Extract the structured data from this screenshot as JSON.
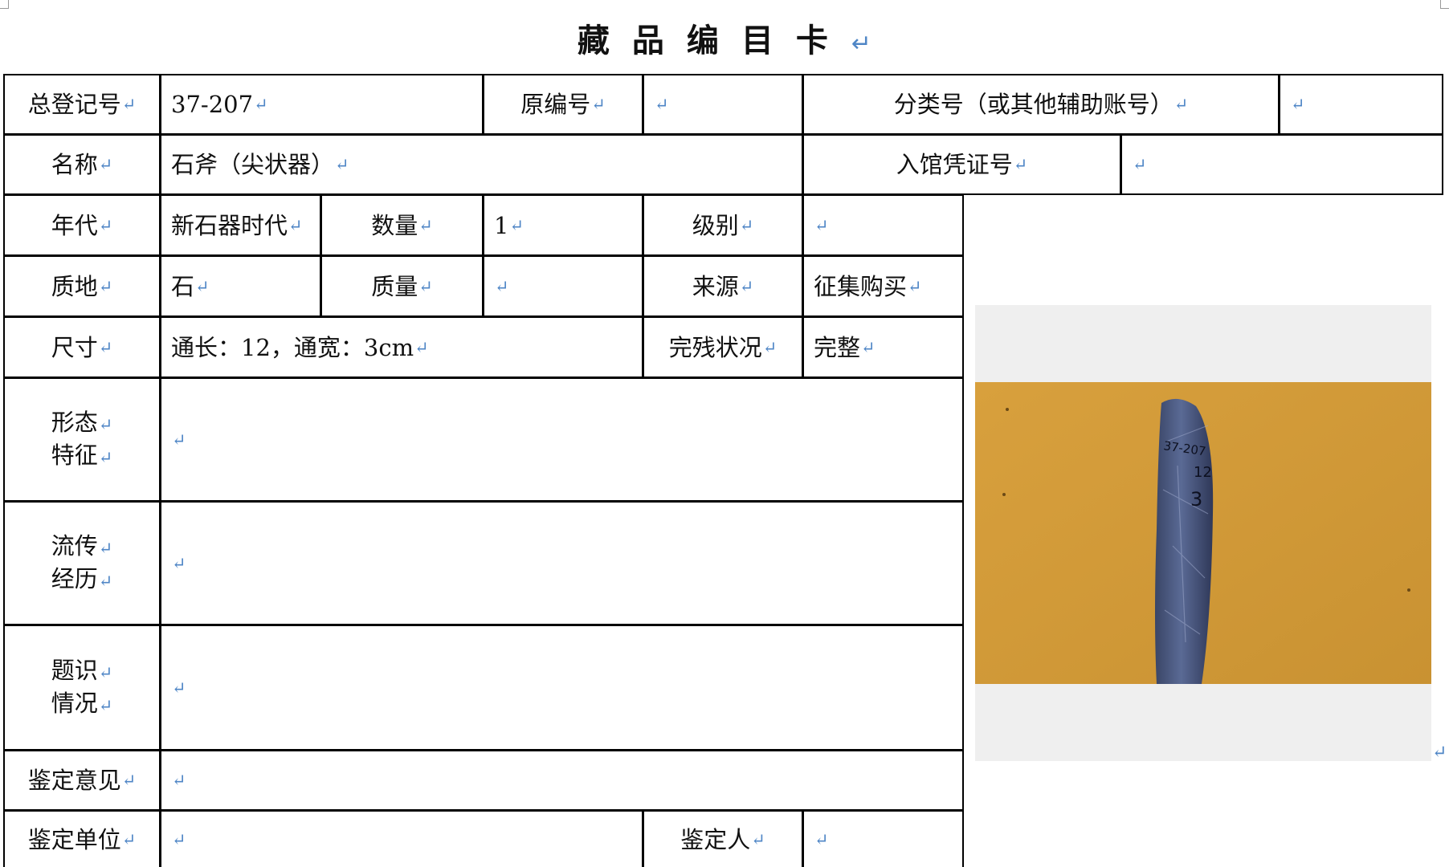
{
  "title": "藏品编目卡",
  "return_mark": "↵",
  "labels": {
    "register_no": "总登记号",
    "original_no": "原编号",
    "classification_no": "分类号（或其他辅助账号）",
    "name": "名称",
    "entry_voucher_no": "入馆凭证号",
    "era": "年代",
    "quantity": "数量",
    "grade": "级别",
    "material": "质地",
    "weight": "质量",
    "source": "来源",
    "dimensions": "尺寸",
    "condition": "完残状况",
    "morphology_line1": "形态",
    "morphology_line2": "特征",
    "provenance_line1": "流传",
    "provenance_line2": "经历",
    "inscription_line1": "题识",
    "inscription_line2": "情况",
    "appraisal_opinion": "鉴定意见",
    "appraisal_unit": "鉴定单位",
    "appraiser": "鉴定人"
  },
  "values": {
    "register_no": "37-207",
    "original_no": "",
    "classification_no": "",
    "name": "石斧（尖状器）",
    "entry_voucher_no": "",
    "era": "新石器时代",
    "quantity": "1",
    "grade": "",
    "material": "石",
    "weight": "",
    "source": "征集购买",
    "dimensions": "通长：12，通宽：3cm",
    "condition": "完整",
    "morphology": "",
    "provenance": "",
    "inscription": "",
    "appraisal_opinion": "",
    "appraisal_unit": "",
    "appraiser": ""
  },
  "photo": {
    "subject": "stone-axe-photo",
    "handwritten_marking": "37-207 12 3",
    "background_color": "#d9a13c",
    "stone_color": "#4a5477",
    "frame_color": "#efefef"
  }
}
